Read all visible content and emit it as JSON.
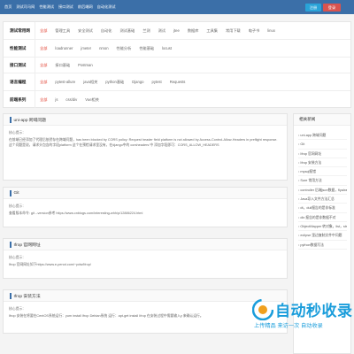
{
  "topbar": {
    "nav": [
      "首页",
      "测试司马网",
      "性能测试",
      "接口测试",
      "前后端网",
      "自动化测试"
    ],
    "login": "注册",
    "register": "登录"
  },
  "filters": [
    {
      "label": "测试常用网",
      "links": [
        "全部",
        "管理工具",
        "安全测试",
        "自动化",
        "测试基础",
        "兰测",
        "测试",
        "jtee",
        "数据库",
        "工具集",
        "常用下载",
        "电子书",
        "linux"
      ]
    },
    {
      "label": "性能测试",
      "links": [
        "全部",
        "loadrunner",
        "jmeter",
        "nmon",
        "性能分析",
        "性能基础",
        "locust"
      ]
    },
    {
      "label": "接口测试",
      "links": [
        "全部",
        "接口基础",
        "Postman"
      ]
    },
    {
      "label": "语言编程",
      "links": [
        "全部",
        "pytest-allure",
        "java相关",
        "python基础",
        "Django",
        "pytest",
        "Requests"
      ]
    },
    {
      "label": "前端系列",
      "links": [
        "全部",
        "js",
        "css/div",
        "Vue相关"
      ]
    }
  ],
  "cards": [
    {
      "title": "uni-app 跨域问题",
      "core": "核心提示：",
      "body": "在前端已经添加了代理后依然存在跨域问题，has been blocked by CORS policy: Request header field platform is not allowed by Access-Control-Allow-Headers in preflight response. 这个问题是说，请求头包含的字段platform 这个在预检请求里没有，在django中的 corsheaders 中 添加字段即可：CORS_ALLOW_HEADERS"
    },
    {
      "title": "Git",
      "core": "核心提示：",
      "body": "查看版本命令: git --version参考 https://www.cnblogs.com/interesting-whh/p/12886224.html"
    },
    {
      "title": "Ifrop 官网网址",
      "core": "核心提示：",
      "body": "Ifrop 官网网址如下https://www.e-penot.com/~pdw/Ifrop/"
    },
    {
      "title": "Ifrop 安装方法",
      "core": "核心提示：",
      "body": "Ifrop 安装在将要在CentOS系统运行：yum install Ifrop Debian系统 运行：apt-get install Ifrop 在安装过程中需要输入y 来确认运行。"
    }
  ],
  "sidebar": {
    "title": "相关新闻",
    "items": [
      "uni-app 跨域问题",
      "Git",
      "Ifrop 官网网址",
      "Ifrop 安装方法",
      "mysql报错",
      "Sure 常用方法",
      "controller 后端json数据，flyalxe 解析json数",
      "Java导入文件方法汇总",
      "dt，dull报告的是非标准",
      "dlx 报告的是非数据不对",
      "ObjectMapper 转对象，list，string的转换",
      "eclipse 里边复制文件中问题",
      "python数据写法"
    ]
  },
  "watermark": {
    "brand": "自动秒收录",
    "tagline": "上传精品 来访一次 自动收录"
  }
}
